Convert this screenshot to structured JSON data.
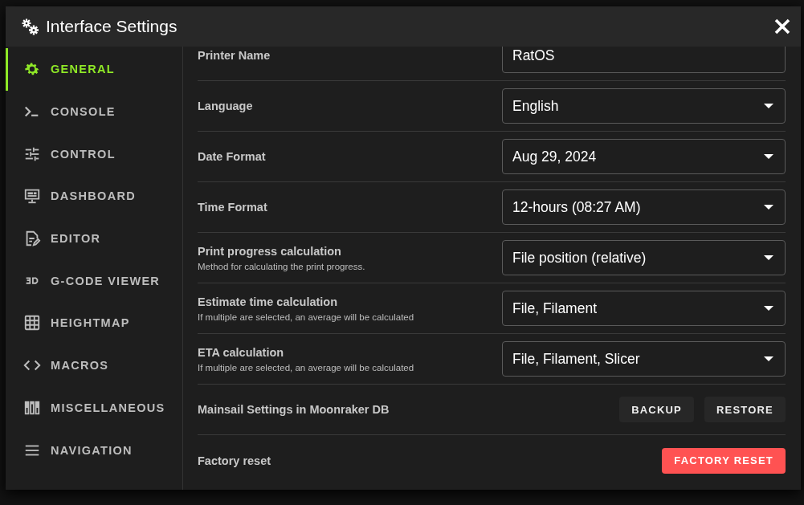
{
  "dialog": {
    "title": "Interface Settings"
  },
  "sidebar": {
    "items": [
      {
        "label": "GENERAL",
        "kind": "gear",
        "selected": true
      },
      {
        "label": "CONSOLE",
        "kind": "console",
        "selected": false
      },
      {
        "label": "CONTROL",
        "kind": "tune",
        "selected": false
      },
      {
        "label": "DASHBOARD",
        "kind": "monitor",
        "selected": false
      },
      {
        "label": "EDITOR",
        "kind": "editor",
        "selected": false
      },
      {
        "label": "G-CODE VIEWER",
        "kind": "cube",
        "selected": false
      },
      {
        "label": "HEIGHTMAP",
        "kind": "grid",
        "selected": false
      },
      {
        "label": "MACROS",
        "kind": "code",
        "selected": false
      },
      {
        "label": "MISCELLANEOUS",
        "kind": "bars",
        "selected": false
      },
      {
        "label": "NAVIGATION",
        "kind": "menu",
        "selected": false
      }
    ]
  },
  "settings": [
    {
      "kind": "text",
      "label": "Printer Name",
      "value": "RatOS"
    },
    {
      "kind": "select",
      "label": "Language",
      "value": "English"
    },
    {
      "kind": "select",
      "label": "Date Format",
      "value": "Aug 29, 2024"
    },
    {
      "kind": "select",
      "label": "Time Format",
      "value": "12-hours (08:27 AM)"
    },
    {
      "kind": "select",
      "label": "Print progress calculation",
      "hint": "Method for calculating the print progress.",
      "value": "File position (relative)"
    },
    {
      "kind": "select",
      "label": "Estimate time calculation",
      "hint": "If multiple are selected, an average will be calculated",
      "value": "File, Filament"
    },
    {
      "kind": "select",
      "label": "ETA calculation",
      "hint": "If multiple are selected, an average will be calculated",
      "value": "File, Filament, Slicer"
    },
    {
      "kind": "buttons",
      "label": "Mainsail Settings in Moonraker DB",
      "buttons": [
        {
          "label": "BACKUP",
          "kind": "plain"
        },
        {
          "label": "RESTORE",
          "kind": "plain"
        }
      ]
    },
    {
      "kind": "buttons",
      "label": "Factory reset",
      "buttons": [
        {
          "label": "FACTORY RESET",
          "kind": "danger"
        }
      ]
    }
  ]
}
